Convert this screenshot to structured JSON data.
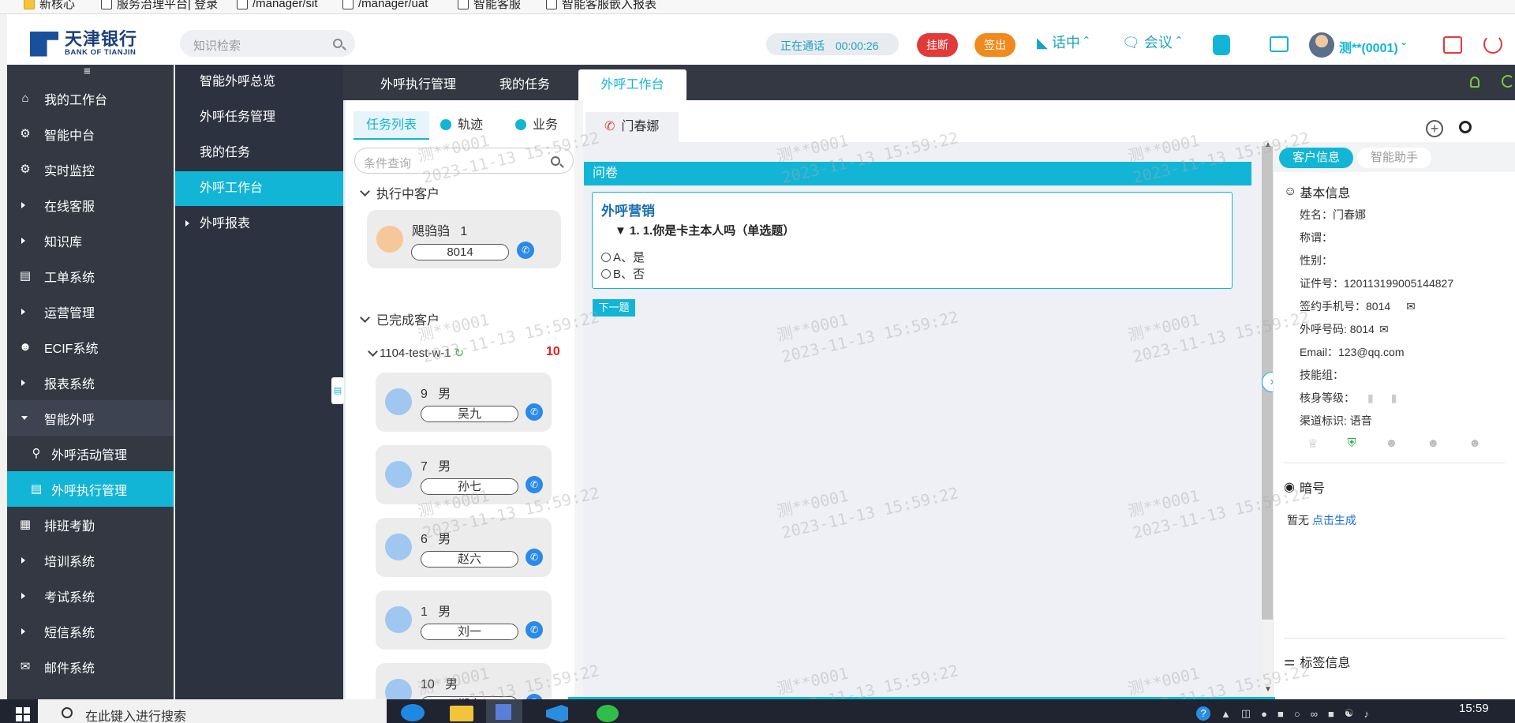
{
  "bookmarks": [
    "新核心",
    "服务治理平台| 登录",
    "/manager/sit",
    "/manager/uat",
    "智能客服",
    "智能客服嵌入报表"
  ],
  "logo": {
    "cn": "天津银行",
    "en": "BANK OF TIANJIN"
  },
  "header": {
    "search_placeholder": "知识检索",
    "call_status": "正在通话",
    "call_time": "00:00:26",
    "hangup": "挂断",
    "signout": "签出",
    "talking": "话中",
    "meeting": "会议",
    "user": "测**(0001)"
  },
  "nav": [
    {
      "label": "我的工作台",
      "icon": "home-icon"
    },
    {
      "label": "智能中台",
      "icon": "shield-icon"
    },
    {
      "label": "实时监控",
      "icon": "monitor-icon"
    },
    {
      "label": "在线客服",
      "icon": "caret-right-icon"
    },
    {
      "label": "知识库",
      "icon": "caret-right-icon"
    },
    {
      "label": "工单系统",
      "icon": "clipboard-icon"
    },
    {
      "label": "运营管理",
      "icon": "caret-right-icon"
    },
    {
      "label": "ECIF系统",
      "icon": "user-icon"
    },
    {
      "label": "报表系统",
      "icon": "caret-right-icon"
    },
    {
      "label": "智能外呼",
      "icon": "caret-down-icon"
    },
    {
      "label": "外呼活动管理",
      "icon": "activity-icon"
    },
    {
      "label": "外呼执行管理",
      "icon": "execute-icon"
    },
    {
      "label": "排班考勤",
      "icon": "calendar-icon"
    },
    {
      "label": "培训系统",
      "icon": "caret-right-icon"
    },
    {
      "label": "考试系统",
      "icon": "caret-right-icon"
    },
    {
      "label": "短信系统",
      "icon": "caret-right-icon"
    },
    {
      "label": "邮件系统",
      "icon": "mail-icon"
    }
  ],
  "sub_nav": [
    "智能外呼总览",
    "外呼任务管理",
    "我的任务",
    "外呼工作台",
    "外呼报表"
  ],
  "top_tabs": [
    "外呼执行管理",
    "我的任务",
    "外呼工作台"
  ],
  "task_panel": {
    "tabs": [
      "任务列表",
      "轨迹",
      "业务"
    ],
    "search_placeholder": "条件查询",
    "executing": "执行中客户",
    "exec_customer": {
      "name": "飓驺驺",
      "num": "1",
      "phone": "8014"
    },
    "done": "已完成客户",
    "group": "1104-test-w-1",
    "group_count": "10",
    "customers": [
      {
        "num": "9",
        "gender": "男",
        "name": "吴九"
      },
      {
        "num": "7",
        "gender": "男",
        "name": "孙七"
      },
      {
        "num": "6",
        "gender": "男",
        "name": "赵六"
      },
      {
        "num": "1",
        "gender": "男",
        "name": "刘一"
      },
      {
        "num": "10",
        "gender": "男",
        "name": "郑十"
      }
    ]
  },
  "call_tab": "门春娜",
  "survey": {
    "header": "问卷",
    "title": "外呼营销",
    "question": "▼ 1. 1.你是卡主本人吗（单选题）",
    "options": [
      "A、是",
      "B、否"
    ],
    "next": "下一题"
  },
  "customer_info": {
    "tabs": [
      "客户信息",
      "智能助手"
    ],
    "basic_title": "基本信息",
    "rows": [
      {
        "k": "姓名：",
        "v": "门春娜"
      },
      {
        "k": "称谓：",
        "v": ""
      },
      {
        "k": "性别：",
        "v": ""
      },
      {
        "k": "证件号：",
        "v": "120113199005144827"
      },
      {
        "k": "签约手机号：",
        "v": "8014"
      },
      {
        "k": "外呼号码: ",
        "v": "8014"
      },
      {
        "k": "Email：",
        "v": "123@qq.com"
      },
      {
        "k": "技能组：",
        "v": ""
      },
      {
        "k": "核身等级：",
        "v": ""
      },
      {
        "k": "渠道标识: ",
        "v": "语音"
      }
    ],
    "code_title": "暗号",
    "code_none": "暂无",
    "code_link": "点击生成",
    "tag_title": "标签信息"
  },
  "watermark": "测**0001\n2023-11-13 15:59:22",
  "taskbar": {
    "search": "在此键入进行搜索",
    "time": "15:59"
  },
  "colors": {
    "accent": "#13b5d6",
    "nav_bg": "#333843",
    "red": "#e23a3a",
    "orange": "#f08a1c"
  }
}
